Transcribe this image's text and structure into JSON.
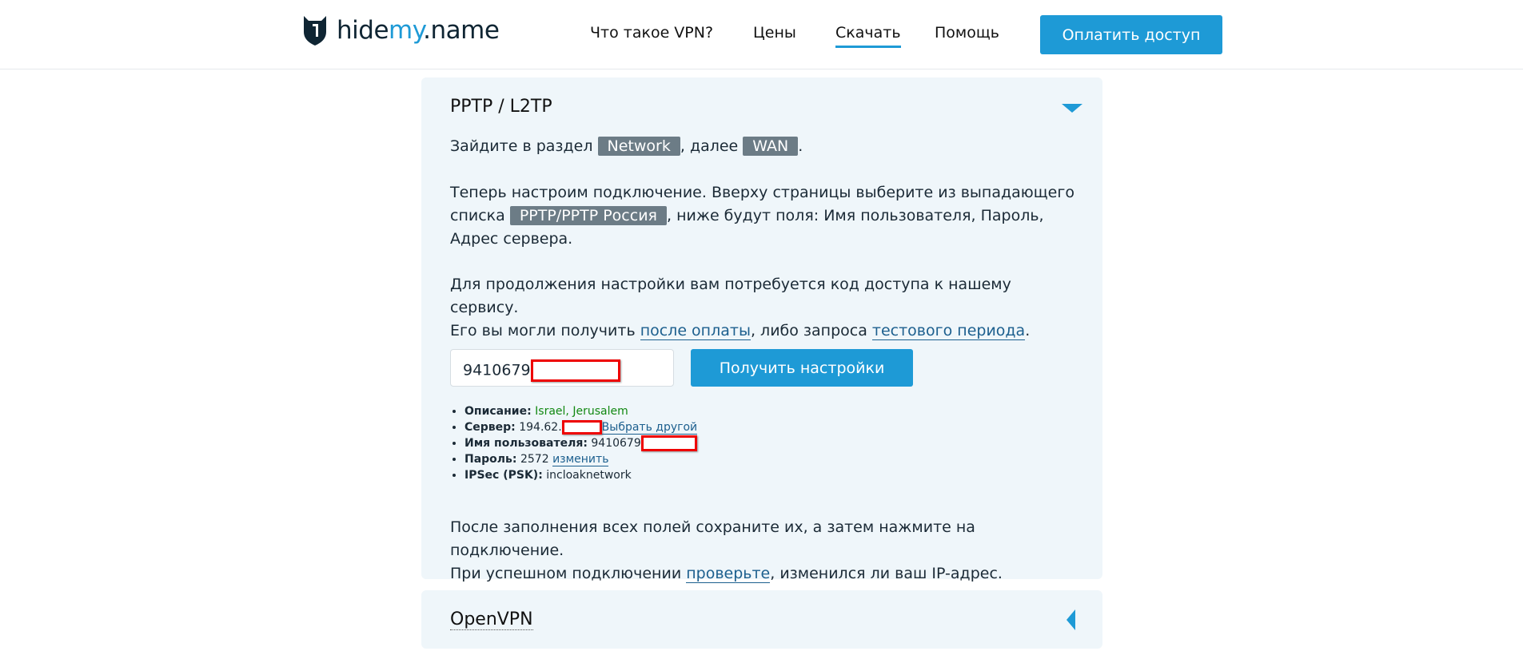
{
  "header": {
    "logo_prefix": "hide",
    "logo_accent": "my",
    "logo_suffix": ".name",
    "nav": [
      {
        "label": "Что такое VPN?"
      },
      {
        "label": "Цены"
      },
      {
        "label": "Скачать",
        "active": true
      },
      {
        "label": "Помощь"
      }
    ],
    "pay_button": "Оплатить доступ"
  },
  "colors": {
    "accent": "#1e9ad6",
    "panel_bg": "#eff6fa",
    "tag_bg": "#6c7c86",
    "success": "#118811"
  },
  "pptp": {
    "title": "PPTP / L2TP",
    "step1": {
      "a": "Зайдите в раздел ",
      "tag1": "Network",
      "b": ", далее ",
      "tag2": "WAN",
      "c": "."
    },
    "step2": {
      "a": "Теперь настроим подключение. Вверху страницы выберите из выпадающего списка ",
      "tag": "PPTP/PPTP Россия",
      "b": ", ниже будут поля: Имя пользователя, Пароль, Адрес сервера."
    },
    "step3": {
      "a": "Для продолжения настройки вам потребуется код доступа к нашему сервису.",
      "b": "Его вы могли получить ",
      "link1": "после оплаты",
      "c": ", либо запроса ",
      "link2": "тестового периода",
      "d": "."
    },
    "code_value": "9410679",
    "get_button": "Получить настройки",
    "details": {
      "desc_label": "Описание:",
      "desc_value": "Israel, Jerusalem",
      "server_label": "Сервер:",
      "server_value": "194.62.",
      "server_link": "Выбрать другой",
      "user_label": "Имя пользователя:",
      "user_value": "9410679",
      "pass_label": "Пароль:",
      "pass_value": "2572",
      "pass_link": "изменить",
      "psk_label": "IPSec (PSK):",
      "psk_value": "incloaknetwork"
    },
    "final": {
      "a": "После заполнения всех полей сохраните их, а затем нажмите на подключение.",
      "b": "При успешном подключении ",
      "link": "проверьте",
      "c": ", изменился ли ваш IP-адрес."
    }
  },
  "openvpn": {
    "title": "OpenVPN"
  }
}
